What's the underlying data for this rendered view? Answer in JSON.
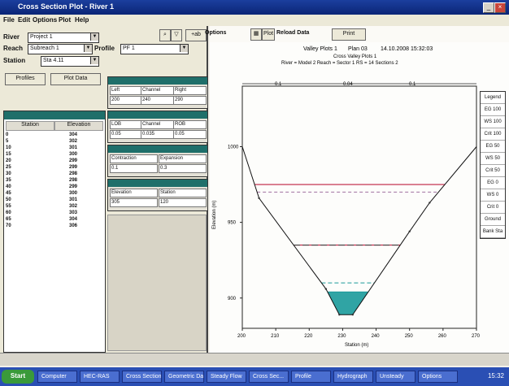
{
  "window": {
    "title": "Cross Section Plot - River 1"
  },
  "menu": {
    "items": [
      "File",
      "Edit",
      "Options",
      "Plot",
      "Help"
    ]
  },
  "controls": {
    "river_label": "River",
    "river_value": "Project 1",
    "reach_label": "Reach",
    "reach_value": "Subreach 1",
    "profile_label": "Profile",
    "profile_value": "PF 1",
    "station_label": "Station",
    "station_value": "Sta 4.11",
    "tab_buttons": [
      "Profiles",
      "Plot Data"
    ]
  },
  "toolbar": {
    "options_label": "Options",
    "plot_label": "Plot",
    "reload_label": "Reload Data",
    "print_label": "Print"
  },
  "left_grid": {
    "columns": [
      "Station",
      "Elevation"
    ],
    "rows": [
      [
        "0",
        "304"
      ],
      [
        "5",
        "302"
      ],
      [
        "10",
        "301"
      ],
      [
        "15",
        "300"
      ],
      [
        "20",
        "299"
      ],
      [
        "25",
        "299"
      ],
      [
        "30",
        "298"
      ],
      [
        "35",
        "298"
      ],
      [
        "40",
        "299"
      ],
      [
        "45",
        "300"
      ],
      [
        "50",
        "301"
      ],
      [
        "55",
        "302"
      ],
      [
        "60",
        "303"
      ],
      [
        "65",
        "304"
      ],
      [
        "70",
        "306"
      ]
    ]
  },
  "panels": [
    {
      "cols": [
        "Left",
        "Channel",
        "Right"
      ],
      "vals": [
        "200",
        "240",
        "290"
      ]
    },
    {
      "cols": [
        "LOB",
        "Channel",
        "ROB"
      ],
      "vals": [
        "0.05",
        "0.035",
        "0.05"
      ]
    },
    {
      "cols": [
        "Contraction",
        "Expansion"
      ],
      "vals": [
        "0.1",
        "0.3"
      ]
    },
    {
      "cols": [
        "Elevation",
        "Station"
      ],
      "vals": [
        "305",
        "120"
      ]
    }
  ],
  "plot": {
    "title": "Valley Plots 1",
    "plan": "Plan 03",
    "datetime": "14.10.2008 15:32:03",
    "subtitle": "Cross Valley Plots 1",
    "info_line": "River = Model 2   Reach = Sector 1   RS = 14   Sections 2",
    "ylabel": "Elevation (m)",
    "xlabel": "Station (m)",
    "bank_labels": [
      "0.1",
      "0.04",
      "0.1"
    ]
  },
  "legend_items": [
    "Legend",
    "EG 100",
    "WS 100",
    "Crit 100",
    "EG 50",
    "WS 50",
    "Crit 50",
    "EG 0",
    "WS 0",
    "Crit 0",
    "Ground",
    "Bank Sta"
  ],
  "chart_data": {
    "type": "line",
    "xlabel": "Station (m)",
    "ylabel": "Elevation (m)",
    "xlim": [
      200,
      270
    ],
    "ylim": [
      880,
      1040
    ],
    "xticks": [
      200,
      210,
      220,
      230,
      240,
      250,
      260,
      270
    ],
    "yticks": [
      900,
      950,
      1000
    ],
    "ground": {
      "x": [
        200,
        205,
        225,
        229,
        233,
        250,
        256,
        270
      ],
      "y": [
        1000,
        966,
        906,
        889,
        889,
        944,
        963,
        1000
      ]
    },
    "levels": [
      {
        "name": "EG 100",
        "y": 1020,
        "color": "#b04060",
        "dash": "6,3"
      },
      {
        "name": "WS 100",
        "y": 975,
        "color": "#c02040",
        "dash": ""
      },
      {
        "name": "Crit 100",
        "y": 970,
        "color": "#a070a0",
        "dash": "4,3"
      },
      {
        "name": "WS 50",
        "y": 935,
        "color": "#c02040",
        "dash": ""
      },
      {
        "name": "Crit 50",
        "y": 935,
        "color": "#404040",
        "dash": "8,3"
      },
      {
        "name": "EG 0",
        "y": 910,
        "color": "#1a9a9a",
        "dash": "5,3"
      },
      {
        "name": "WS 0",
        "y": 904,
        "color": "#1a9a9a",
        "dash": ""
      }
    ],
    "fill_color": "#1a9a9a"
  },
  "status": {
    "text": ""
  },
  "taskbar": {
    "start_label": "Start",
    "tasks": [
      "Computer",
      "HEC-RAS",
      "Cross Section",
      "Geometric Data",
      "Steady Flow",
      "Cross Sec...",
      "Profile",
      "Hydrograph",
      "Unsteady",
      "Options"
    ],
    "clock": "15:32"
  }
}
